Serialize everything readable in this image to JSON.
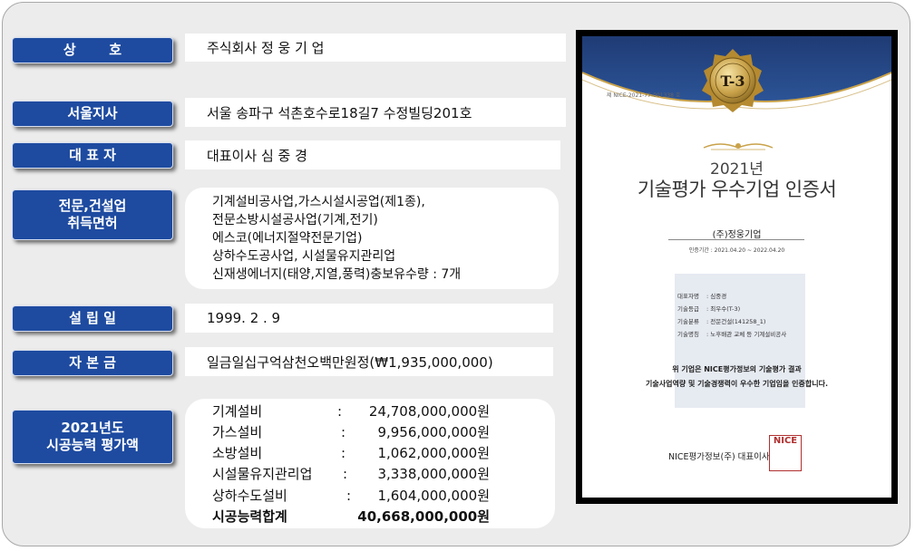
{
  "rows": {
    "company": {
      "label": "상       호",
      "value": "주식회사 정 웅 기 업"
    },
    "branch": {
      "label": "서울지사",
      "value": "서울 송파구 석촌호수로18길7 수정빌딩201호"
    },
    "ceo": {
      "label": "대 표 자",
      "value": "대표이사 심  중  경"
    },
    "license": {
      "label": "전문,건설업\n취득면허",
      "lines": [
        "기계설비공사업,가스시설시공업(제1종),",
        "전문소방시설공사업(기계,전기)",
        "에스코(에너지절약전문기업)",
        "상하수도공사업, 시설물유지관리업",
        "신재생에너지(태양,지열,풍력)충보유수량  : 7개"
      ]
    },
    "founded": {
      "label": "설 립 일",
      "value": "1999. 2 . 9"
    },
    "capital": {
      "label": "자 본 금",
      "value": "일금일십구억삼천오백만원정(₩1,935,000,000)"
    },
    "performance": {
      "label": "2021년도\n시공능력 평가액",
      "items": [
        {
          "name": "기계설비",
          "colon": ":",
          "amount": "24,708,000,000원"
        },
        {
          "name": "가스설비",
          "colon": ":",
          "amount": "9,956,000,000원"
        },
        {
          "name": "소방설비",
          "colon": ":",
          "amount": "1,062,000,000원"
        },
        {
          "name": "시설물유지관리업",
          "colon": ":",
          "amount": "3,338,000,000원"
        },
        {
          "name": "상하수도설비",
          "colon": ":",
          "amount": "1,604,000,000원"
        }
      ],
      "total": {
        "name": "시공능력합계",
        "amount": "40,668,000,000원"
      }
    }
  },
  "certificate": {
    "doc_no": "제 NICE-2021-77-001338 호",
    "grade": "T-3",
    "year": "2021년",
    "title": "기술평가 우수기업 인증서",
    "company": "(주)정웅기업",
    "period": "인증기간 : 2021.04.20 ~ 2022.04.20",
    "details": [
      {
        "k": "대표자명",
        "v": ":  심중경"
      },
      {
        "k": "기술등급",
        "v": ":  최우수(T-3)"
      },
      {
        "k": "기술분류",
        "v": ":  전문건설(141258_1)"
      },
      {
        "k": "기술명칭",
        "v": ":  노후배관 교체 등 기계설비공사"
      }
    ],
    "statement": [
      "위 기업은 NICE평가정보의 기술평가 결과",
      "기술사업역량 및 기술경쟁력이 우수한 기업임을 인증합니다."
    ],
    "issuer": "NICE평가정보(주) 대표이사",
    "seal": "NICE",
    "colors": {
      "navy": "#1f3b75",
      "gold": "#c9a24a",
      "label_blue": "#1e4ba0"
    }
  }
}
